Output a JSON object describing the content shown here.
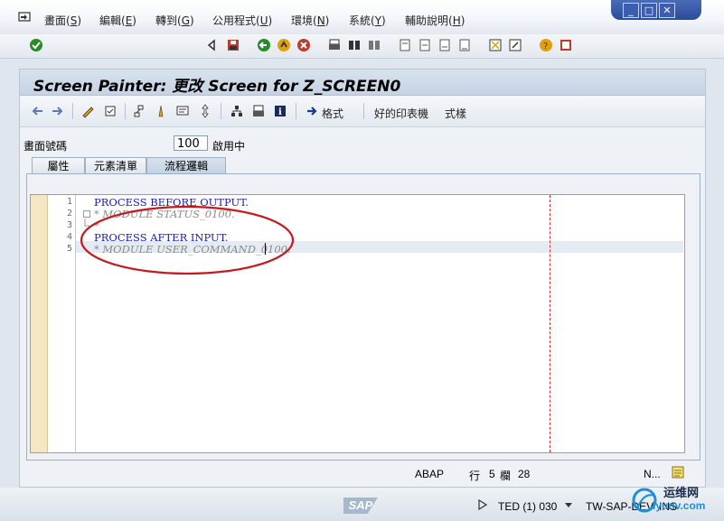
{
  "menu": {
    "items": [
      {
        "label": "畫面(",
        "key": "S",
        "end": ")"
      },
      {
        "label": "編輯(",
        "key": "E",
        "end": ")"
      },
      {
        "label": "轉到(",
        "key": "G",
        "end": ")"
      },
      {
        "label": "公用程式(",
        "key": "U",
        "end": ")"
      },
      {
        "label": "環境(",
        "key": "N",
        "end": ")"
      },
      {
        "label": "系統(",
        "key": "Y",
        "end": ")"
      },
      {
        "label": "輔助說明(",
        "key": "H",
        "end": ")"
      }
    ]
  },
  "command_field": {
    "value": ""
  },
  "title": "Screen Painter: 更改 Screen for Z_SCREEN0",
  "app_toolbar": {
    "format_label": "格式",
    "printer_label": "好的印表機",
    "style_label": "式樣"
  },
  "screen_number": {
    "label": "畫面號碼",
    "value": "100",
    "status": "啟用中"
  },
  "tabs": [
    {
      "label": "屬性",
      "active": false
    },
    {
      "label": "元素清單",
      "active": false
    },
    {
      "label": "流程邏輯",
      "active": true
    }
  ],
  "code_lines": [
    {
      "num": "1",
      "text": "PROCESS BEFORE OUTPUT.",
      "type": "keyword"
    },
    {
      "num": "2",
      "text": "* MODULE STATUS_0100.",
      "type": "comment"
    },
    {
      "num": "3",
      "text": "*",
      "type": "comment"
    },
    {
      "num": "4",
      "text": "PROCESS AFTER INPUT.",
      "type": "keyword"
    },
    {
      "num": "5",
      "text": "* MODULE USER_COMMAND_0100.",
      "type": "comment"
    }
  ],
  "editor_status": {
    "language": "ABAP",
    "line_label": "行",
    "line": "5",
    "col_label": "欄",
    "col": "28",
    "mode": "N..."
  },
  "footer": {
    "logo": "SAP",
    "session": "TED (1) 030",
    "server": "TW-SAP-DEV",
    "mode": "INS"
  },
  "watermark": {
    "line1": "运维网",
    "line2": "iyunv.com"
  },
  "colors": {
    "title_bg": "#c5d3e4",
    "annotation": "#c8181e",
    "keyword": "#1a1ab8",
    "comment": "#8a8a8a"
  }
}
